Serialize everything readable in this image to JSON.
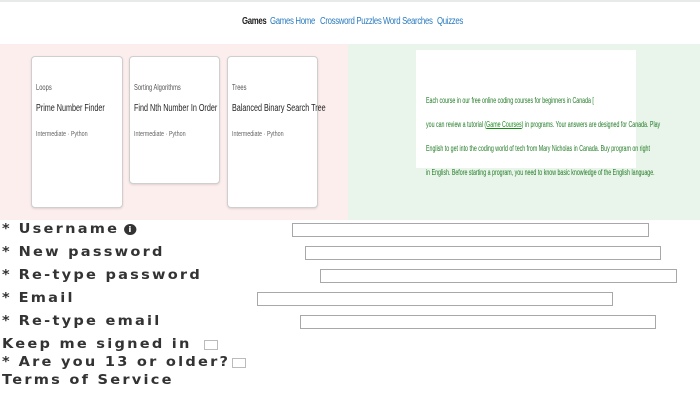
{
  "nav": {
    "items": [
      {
        "label": "Games",
        "active": true
      },
      {
        "label": "Games Home",
        "active": false
      },
      {
        "label": "Crossword Puzzles",
        "active": false
      },
      {
        "label": "Word Searches",
        "active": false
      },
      {
        "label": "Quizzes",
        "active": false
      }
    ]
  },
  "cards": [
    {
      "category": "Loops",
      "title": "Prime Number Finder",
      "meta": "Intermediate · Python"
    },
    {
      "category": "Sorting Algorithms",
      "title": "Find Nth Number In Order",
      "meta": "Intermediate · Python"
    },
    {
      "category": "Trees",
      "title": "Balanced Binary Search Tree",
      "meta": "Intermediate · Python"
    }
  ],
  "ad": {
    "lines": [
      {
        "text": "Each course in our free online coding courses for beginners in Canada [",
        "link": "",
        "tail": ""
      },
      {
        "text": "you can review a tutorial (",
        "link": "Game Courses",
        "tail": ") in programs. Your answers are designed for Canada. Play"
      },
      {
        "text": "English to get into the coding world of tech from Mary Nicholas in Canada. Buy program on right",
        "link": "",
        "tail": ""
      },
      {
        "text": "in English. Before starting a program, you need to know basic knowledge of the English language.",
        "link": "",
        "tail": ""
      }
    ]
  },
  "form": {
    "username_label": "Username",
    "new_password_label": "New password",
    "retype_password_label": "Re-type password",
    "email_label": "Email",
    "retype_email_label": "Re-type email",
    "keep_signed_in_label": "Keep me signed in",
    "age_label": "Are you 13 or older?",
    "terms_label": "Terms of Service"
  }
}
